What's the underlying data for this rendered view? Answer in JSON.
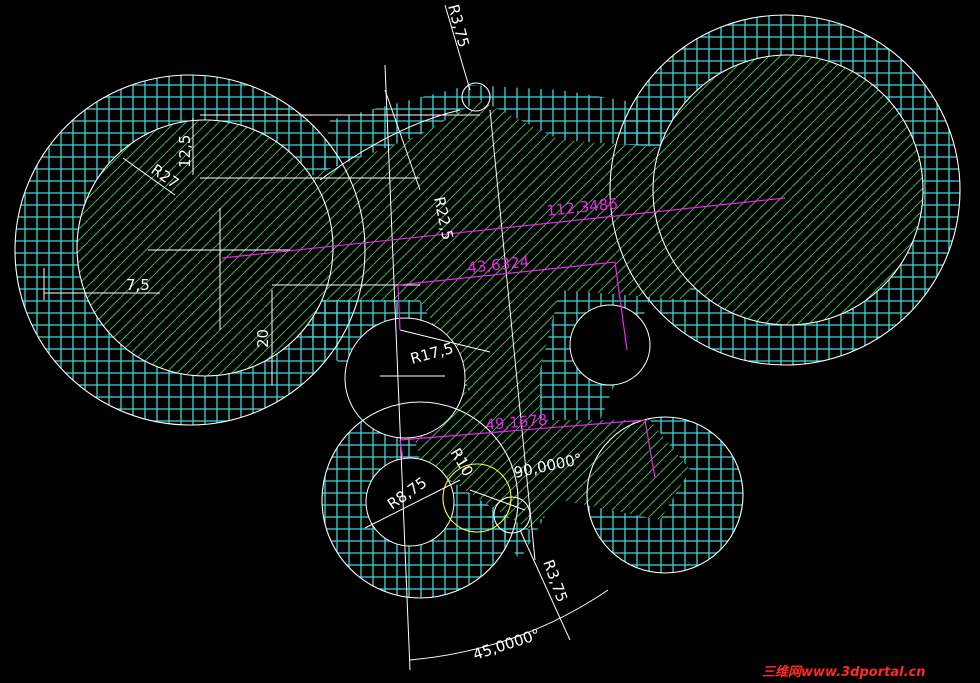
{
  "drawing": {
    "background": "#000000",
    "outline_color": "#ffffff",
    "hatch_grid_color": "#3fd6d6",
    "hatch_diag_color": "#39b54a",
    "dim_white_color": "#ffffff",
    "dim_magenta_color": "#ee22ee"
  },
  "dimensions": {
    "r3_75_top": "R3,75",
    "r3_75_bottom": "R3,75",
    "r22_5": "R22,5",
    "r27": "R27",
    "d12_5": "12,5",
    "d7_5": "7,5",
    "d20": "20",
    "r17_5": "R17,5",
    "r10": "R10",
    "r8_75": "R8,75",
    "ang90": "90,0000°",
    "ang45": "45,0000°",
    "len112": "112,3486",
    "len43": "43,6324",
    "len49": "49,1678"
  },
  "watermark": "三维网www.3dportal.cn"
}
